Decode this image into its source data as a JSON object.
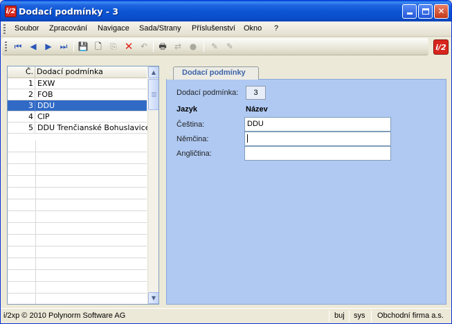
{
  "window": {
    "title": "Dodací podmínky - 3",
    "logo_text": "i/2",
    "controls": {
      "minimize": "_",
      "maximize": "□",
      "close": "✕"
    }
  },
  "menu": [
    "Soubor",
    "Zpracování",
    "Navigace",
    "Sada/Strany",
    "Příslušenství",
    "Okno",
    "?"
  ],
  "toolbar": {
    "icons": [
      "first-icon",
      "prev-icon",
      "next-icon",
      "last-icon",
      "save-icon",
      "new-icon",
      "copy-icon",
      "delete-icon",
      "undo-icon",
      "print-icon",
      "link-icon",
      "lock-icon",
      "edit-icon",
      "clear-icon"
    ],
    "glyphs": {
      "first": "⏮",
      "prev": "◀",
      "next": "▶",
      "last": "⏭",
      "save": "💾",
      "new": "🗋",
      "copy": "⎘",
      "delete": "✕",
      "undo": "↶",
      "print": "🖶",
      "link": "⇄",
      "lock": "●",
      "edit": "✎",
      "clear": "✎"
    },
    "brand_logo": "i/2"
  },
  "grid": {
    "col_num": "Č.",
    "col_name": "Dodací podmínka",
    "rows": [
      {
        "num": "1",
        "name": "EXW"
      },
      {
        "num": "2",
        "name": "FOB"
      },
      {
        "num": "3",
        "name": "DDU"
      },
      {
        "num": "4",
        "name": "CIP"
      },
      {
        "num": "5",
        "name": "DDU Trenčianské Bohuslavice"
      }
    ],
    "selected_index": 2,
    "scroll": {
      "up": "▲",
      "down": "▼"
    }
  },
  "detail": {
    "tab_label": "Dodací podmínky",
    "id_label": "Dodací podmínka:",
    "id_value": "3",
    "col_language": "Jazyk",
    "col_name": "Název",
    "languages": [
      {
        "label": "Čeština:",
        "value": "DDU"
      },
      {
        "label": "Němčina:",
        "value": ""
      },
      {
        "label": "Angličtina:",
        "value": ""
      }
    ]
  },
  "status": {
    "copyright": "i/2xp © 2010 Polynorm Software AG",
    "user": "buj",
    "db": "sys",
    "company": "Obchodní firma a.s."
  },
  "colors": {
    "titlebar": "#0B55D4",
    "selection": "#316AC5",
    "panel": "#AFC9F2",
    "brand": "#D7261E"
  }
}
